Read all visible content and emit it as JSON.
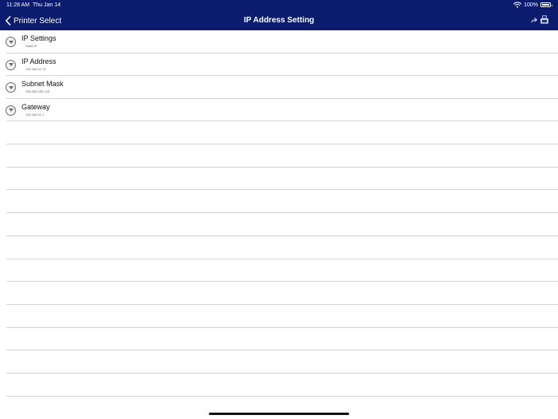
{
  "status_bar": {
    "time": "11:28 AM",
    "date": "Thu Jan 14",
    "battery": "100%",
    "icons": [
      "wifi-icon",
      "battery-icon"
    ]
  },
  "nav": {
    "back_label": "Printer Select",
    "title": "IP Address Setting",
    "actions": [
      "share-arrow-icon",
      "printer-icon"
    ]
  },
  "colors": {
    "header_bg": "#0b1b6e",
    "header_text": "#ffffff",
    "separator": "#d4d4d4"
  },
  "settings": [
    {
      "title": "IP Settings",
      "value": "Static IP"
    },
    {
      "title": "IP Address",
      "value": "192.168.11.13"
    },
    {
      "title": "Subnet Mask",
      "value": "255.255.255.128"
    },
    {
      "title": "Gateway",
      "value": "192.168.11.1"
    }
  ]
}
